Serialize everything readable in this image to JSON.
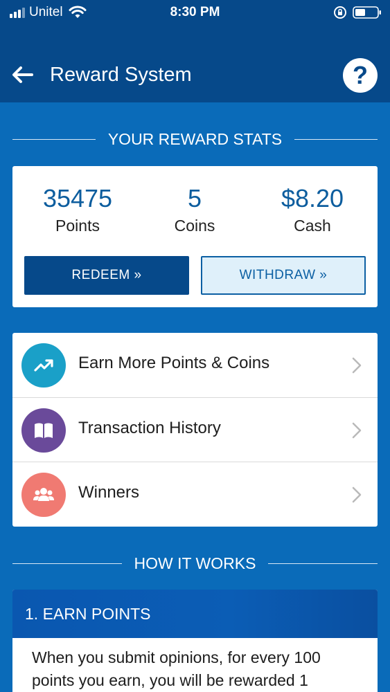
{
  "status_bar": {
    "carrier": "Unitel",
    "time": "8:30 PM",
    "icons": [
      "signal-icon",
      "wifi-icon",
      "rotation-lock-icon",
      "battery-icon"
    ]
  },
  "header": {
    "title": "Reward System",
    "back_icon": "back-arrow-icon",
    "help_label": "?"
  },
  "stats_section": {
    "heading": "YOUR REWARD STATS",
    "stats": [
      {
        "value": "35475",
        "label": "Points"
      },
      {
        "value": "5",
        "label": "Coins"
      },
      {
        "value": "$8.20",
        "label": "Cash"
      }
    ],
    "redeem_label": "REDEEM »",
    "withdraw_label": "WITHDRAW »"
  },
  "menu": {
    "items": [
      {
        "label": "Earn More Points & Coins",
        "icon": "trending-up-icon",
        "color": "#1aa0c8"
      },
      {
        "label": "Transaction History",
        "icon": "book-icon",
        "color": "#6a4a9a"
      },
      {
        "label": "Winners",
        "icon": "group-icon",
        "color": "#f07a72"
      }
    ]
  },
  "how_section": {
    "heading": "HOW IT WORKS",
    "step_title": "1. EARN POINTS",
    "step_text": "When you submit opinions, for every 100 points you earn, you will be rewarded 1"
  },
  "colors": {
    "primary": "#06498a",
    "background": "#0a6bb9",
    "accent_text": "#0c5d9e"
  }
}
